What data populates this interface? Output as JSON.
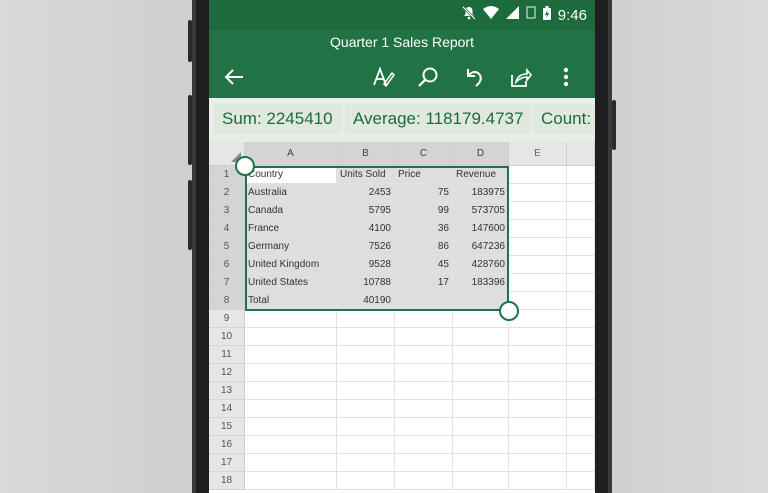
{
  "status": {
    "time": "9:46"
  },
  "app": {
    "title": "Quarter 1 Sales Report"
  },
  "toolbar": {
    "icons": [
      "back-arrow-icon",
      "text-format-icon",
      "search-icon",
      "undo-icon",
      "share-icon",
      "more-vert-icon"
    ]
  },
  "summary": {
    "sum": "Sum: 2245410",
    "average": "Average: 118179.4737",
    "count": "Count:"
  },
  "sheet": {
    "column_headers": [
      "A",
      "B",
      "C",
      "D",
      "E"
    ],
    "row_headers": [
      "1",
      "2",
      "3",
      "4",
      "5",
      "6",
      "7",
      "8",
      "9",
      "10",
      "11",
      "12",
      "13",
      "14",
      "15",
      "16",
      "17",
      "18"
    ],
    "header_row": [
      "Country",
      "Units Sold",
      "Price",
      "Revenue"
    ],
    "rows": [
      [
        "Australia",
        "2453",
        "75",
        "183975"
      ],
      [
        "Canada",
        "5795",
        "99",
        "573705"
      ],
      [
        "France",
        "4100",
        "36",
        "147600"
      ],
      [
        "Germany",
        "7526",
        "86",
        "647236"
      ],
      [
        "United Kingdom",
        "9528",
        "45",
        "428760"
      ],
      [
        "United States",
        "10788",
        "17",
        "183396"
      ],
      [
        "Total",
        "40190",
        "",
        ""
      ]
    ]
  },
  "colors": {
    "accent": "#217346",
    "statusbar": "#1d6b3c",
    "chip_bg": "#dfe9de"
  }
}
